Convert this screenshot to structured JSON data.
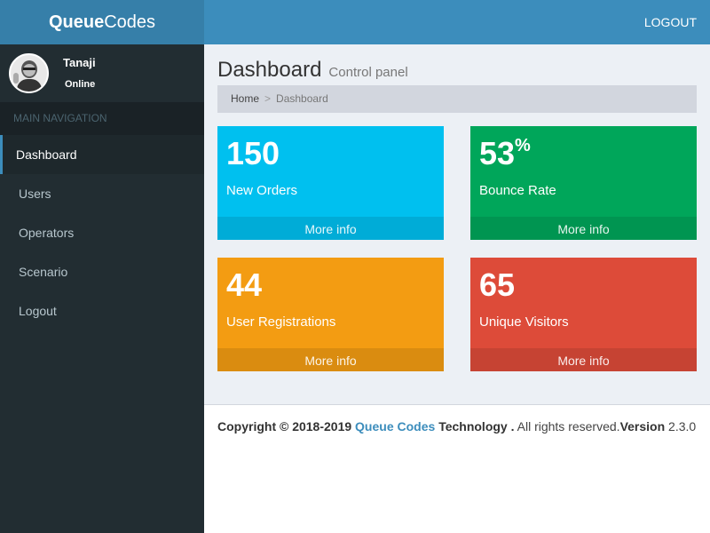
{
  "brand": {
    "bold": "Queue",
    "regular": "Codes"
  },
  "header": {
    "logout_label": "LOGOUT"
  },
  "user": {
    "name": "Tanaji",
    "status": "Online"
  },
  "sidebar": {
    "header": "MAIN NAVIGATION",
    "items": [
      {
        "label": "Dashboard",
        "active": true
      },
      {
        "label": "Users"
      },
      {
        "label": "Operators"
      },
      {
        "label": "Scenario"
      },
      {
        "label": "Logout"
      }
    ]
  },
  "page": {
    "title": "Dashboard",
    "subtitle": "Control panel"
  },
  "breadcrumb": {
    "home": "Home",
    "separator": ">",
    "current": "Dashboard"
  },
  "stats": [
    {
      "value": "150",
      "suffix": "",
      "label": "New Orders",
      "more": "More info",
      "color": "#00c0ef"
    },
    {
      "value": "53",
      "suffix": "%",
      "label": "Bounce Rate",
      "more": "More info",
      "color": "#00a65a"
    },
    {
      "value": "44",
      "suffix": "",
      "label": "User Registrations",
      "more": "More info",
      "color": "#f39c12"
    },
    {
      "value": "65",
      "suffix": "",
      "label": "Unique Visitors",
      "more": "More info",
      "color": "#dd4b39"
    }
  ],
  "footer": {
    "copyright": "Copyright © 2018-2019",
    "company_link": "Queue Codes",
    "company_suffix": "Technology .",
    "rights": "All rights reserved.",
    "version_label": "Version",
    "version": "2.3.0"
  },
  "colors": {
    "topbar": "#3c8dbc",
    "logo_bg": "#367fa9",
    "sidebar": "#222d32",
    "content_bg": "#ecf0f5"
  }
}
